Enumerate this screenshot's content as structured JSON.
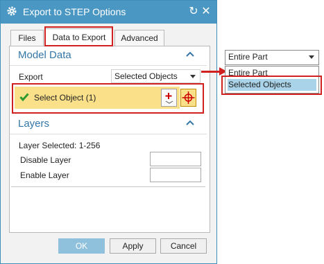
{
  "dialog": {
    "title": "Export to STEP Options",
    "tabs": [
      {
        "label": "Files"
      },
      {
        "label": "Data to Export",
        "active": true
      },
      {
        "label": "Advanced"
      }
    ],
    "model_data": {
      "title": "Model Data",
      "export_label": "Export",
      "export_value": "Selected Objects",
      "select_object_label": "Select Object (1)"
    },
    "layers": {
      "title": "Layers",
      "layer_selected": "Layer Selected: 1-256",
      "disable_label": "Disable Layer",
      "disable_value": "",
      "enable_label": "Enable Layer",
      "enable_value": ""
    },
    "buttons": {
      "ok": "OK",
      "apply": "Apply",
      "cancel": "Cancel"
    }
  },
  "dropdown_callout": {
    "current_value": "Entire Part",
    "options": [
      "Entire Part",
      "Selected Objects"
    ],
    "selected_option": "Selected Objects"
  },
  "colors": {
    "title_bar": "#4a97c4",
    "section_title": "#3477a7",
    "selection_row": "#fbe08a",
    "highlight": "#d02020",
    "selected_option": "#a9d3e8"
  }
}
